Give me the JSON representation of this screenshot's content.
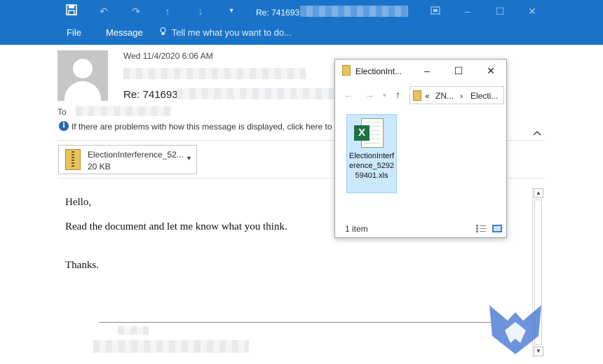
{
  "outlook": {
    "title": "Re: 741693个",
    "menu": {
      "file": "File",
      "message": "Message"
    },
    "tell_me": "Tell me what you want to do...",
    "message": {
      "date": "Wed 11/4/2020 6:06 AM",
      "subject": "Re: 741693",
      "to_label": "To",
      "info_bar": "If there are problems with how this message is displayed, click here to vi"
    },
    "attachment": {
      "name": "ElectionInterference_52...",
      "size": "20 KB"
    },
    "body": {
      "greeting": "Hello,",
      "line1": "Read the document and let me know what you think.",
      "closing": "Thanks."
    }
  },
  "explorer": {
    "title": "ElectionInt...",
    "address": {
      "prefix": "«",
      "folder1": "ZN...",
      "separator": "›",
      "folder2": "Electi..."
    },
    "file": {
      "name": "ElectionInterference_529259401.xls"
    },
    "status": "1 item"
  },
  "icons": {
    "save": "save-icon",
    "undo": "undo-icon",
    "redo": "redo-icon",
    "up": "arrow-up-icon",
    "down": "arrow-down-icon",
    "customize": "customize-icon",
    "restore": "restore-icon",
    "minimize": "minimize-icon",
    "maximize": "maximize-icon",
    "close": "close-icon",
    "lightbulb": "lightbulb-icon",
    "info": "info-icon",
    "zip": "zip-file-icon",
    "excel": "excel-file-icon",
    "folder": "folder-icon",
    "watermark": "malwarebytes-logo"
  },
  "colors": {
    "ribbon": "#1a73c9",
    "selection": "#cce8ff",
    "excel": "#1e7145",
    "watermark": "#3b6fcf"
  }
}
